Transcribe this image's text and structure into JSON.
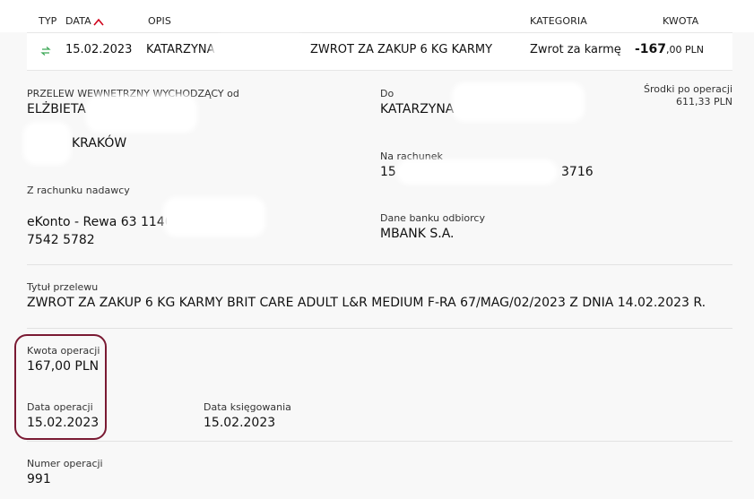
{
  "table_header": {
    "typ": "TYP",
    "data": "DATA",
    "opis": "OPIS",
    "kategoria": "KATEGORIA",
    "kwota": "KWOTA"
  },
  "row": {
    "type_icon": "transfer-arrows-icon",
    "date": "15.02.2023",
    "recipient": "KATARZYNA",
    "description": "ZWROT ZA ZAKUP 6 KG KARMY",
    "category": "Zwrot za karmę",
    "amount_int": "-167",
    "amount_rest": ",00 PLN"
  },
  "details": {
    "from_label": "PRZELEW WEWNETRZNY WYCHODZĄCY od",
    "from_name": "ELŻBIETA",
    "from_city": "KRAKÓW",
    "to_label": "Do",
    "to_name": "KATARZYNA",
    "balance_label": "Środki po operacji",
    "balance_value": "611,33 PLN",
    "account_to_label": "Na rachunek",
    "account_to_start": "15",
    "account_to_end": "3716",
    "sender_account_label": "Z rachunku nadawcy",
    "sender_account_line1": "eKonto - Rewa 63 1140",
    "sender_account_line2": "7542 5782",
    "bank_label": "Dane banku odbiorcy",
    "bank_value": "MBANK S.A.",
    "title_label": "Tytuł przelewu",
    "title_value": "ZWROT ZA ZAKUP 6 KG KARMY BRIT CARE ADULT L&R MEDIUM F-RA 67/MAG/02/2023 Z DNIA 14.02.2023 R.",
    "amount_label": "Kwota operacji",
    "amount_value": "167,00 PLN",
    "op_date_label": "Data operacji",
    "op_date_value": "15.02.2023",
    "book_date_label": "Data księgowania",
    "book_date_value": "15.02.2023",
    "op_number_label": "Numer operacji",
    "op_number_value": "991"
  },
  "colors": {
    "accent_red": "#d0021b",
    "highlight_border": "#7a1a33",
    "transfer_icon": "#3aa655"
  }
}
